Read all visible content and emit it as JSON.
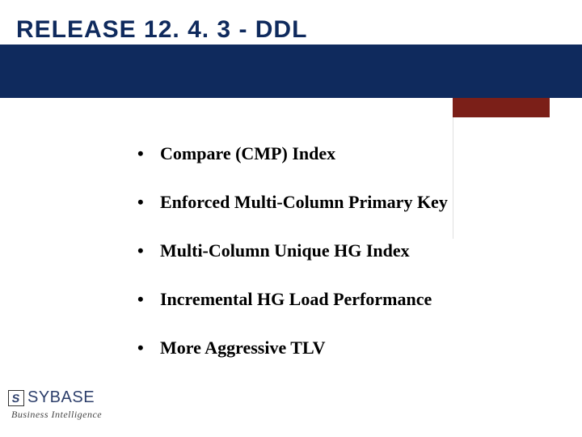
{
  "title": "RELEASE 12. 4. 3 - DDL",
  "bullets": [
    "Compare (CMP) Index",
    "Enforced Multi-Column Primary Key",
    "Multi-Column Unique HG Index",
    "Incremental HG Load Performance",
    "More Aggressive TLV"
  ],
  "footer": {
    "brand": "SYBASE",
    "subline": "Business Intelligence",
    "mark_letter": "S"
  },
  "colors": {
    "navy": "#0f2a5d",
    "brown": "#7b1f18",
    "brand_blue": "#2d3f6b"
  }
}
